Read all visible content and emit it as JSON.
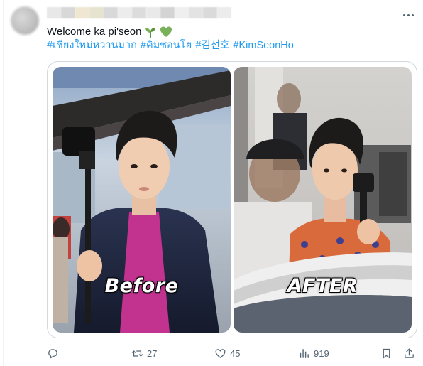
{
  "tweet": {
    "text": "Welcome ka pi'seon",
    "emojis": [
      "seedling-emoji",
      "green-heart-emoji"
    ],
    "hashtags": [
      "#เชียงใหม่หวานมาก",
      "#คิมซอนโฮ",
      "#김선호",
      "#KimSeonHo"
    ]
  },
  "media": {
    "left_caption": "Before",
    "right_caption": "AFTER"
  },
  "actions": {
    "reply_count": "",
    "retweet_count": "27",
    "like_count": "45",
    "view_count": "919"
  },
  "colors": {
    "link": "#1d9bf0",
    "text": "#0f1419",
    "muted": "#536471",
    "border": "#cfd9de"
  },
  "icons": {
    "reply": "reply-icon",
    "retweet": "retweet-icon",
    "like": "heart-icon",
    "views": "bar-chart-icon",
    "bookmark": "bookmark-icon",
    "share": "share-icon",
    "more": "more-dots-icon"
  }
}
